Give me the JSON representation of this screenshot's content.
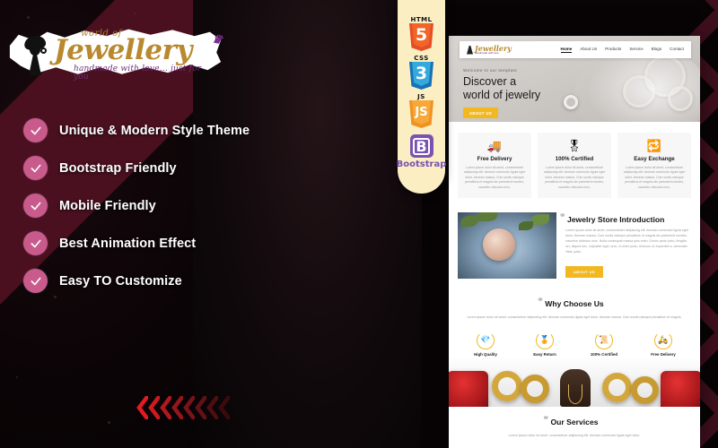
{
  "brand": {
    "pre": "world of",
    "name": "Jewellery",
    "tagline": "handmade with love... just for you",
    "crown_icon": "crown-icon",
    "accent_gold": "#b8892f",
    "accent_purple": "#6d2e7e"
  },
  "features": {
    "check_color": "#c85b8c",
    "items": [
      {
        "label": "Unique & Modern Style Theme"
      },
      {
        "label": "Bootstrap Friendly"
      },
      {
        "label": "Mobile Friendly"
      },
      {
        "label": "Best Animation Effect"
      },
      {
        "label": "Easy TO Customize"
      }
    ]
  },
  "tech_badges": {
    "panel_color": "#fbeec3",
    "items": [
      {
        "cap": "HTML",
        "num": "5",
        "color": "#e44d26",
        "inner": "#f16529",
        "icon": "html5-icon"
      },
      {
        "cap": "CSS",
        "num": "3",
        "color": "#1572b6",
        "inner": "#33a9dc",
        "icon": "css3-icon"
      },
      {
        "cap": "JS",
        "num": "JS",
        "color": "#f7941e",
        "inner": "#f7941e",
        "icon": "javascript-icon"
      },
      {
        "cap": "",
        "num": "B",
        "color": "#7952b3",
        "inner": "#7952b3",
        "icon": "bootstrap-icon",
        "label": "Bootstrap"
      }
    ]
  },
  "mockup": {
    "nav": {
      "logo_pre": "world of",
      "logo_name": "Jewellery",
      "logo_sub": "handmade with love",
      "links": [
        {
          "label": "Home",
          "active": true
        },
        {
          "label": "About Us",
          "active": false
        },
        {
          "label": "Products",
          "active": false
        },
        {
          "label": "Service",
          "active": false
        },
        {
          "label": "Blogs",
          "active": false
        },
        {
          "label": "Contact",
          "active": false
        }
      ]
    },
    "hero": {
      "eyebrow": "Welcome to our template",
      "title_line1": "Discover a",
      "title_line2": "world of jewelry",
      "button": "ABOUT US",
      "button_color": "#f1b821"
    },
    "cards": [
      {
        "icon": "delivery-truck-icon",
        "glyph": "🚚",
        "title": "Free Delivery",
        "body": "Lorem ipsum dolor sit amet, consectetuer adipiscing elit. Aenean commodo ligula eget dolor. Aenean massa. Cum sociis natoque penatibus et magnis dis parturient montes, nascetur ridiculus mus."
      },
      {
        "icon": "certified-badge-icon",
        "glyph": "🎖",
        "title": "100% Certified",
        "body": "Lorem ipsum dolor sit amet, consectetuer adipiscing elit. Aenean commodo ligula eget dolor. Aenean massa. Cum sociis natoque penatibus et magnis dis parturient montes, nascetur ridiculus mus."
      },
      {
        "icon": "exchange-arrows-icon",
        "glyph": "🔁",
        "title": "Easy Exchange",
        "body": "Lorem ipsum dolor sit amet, consectetuer adipiscing elit. Aenean commodo ligula eget dolor. Aenean massa. Cum sociis natoque penatibus et magnis dis parturient montes, nascetur ridiculus mus."
      }
    ],
    "intro": {
      "heading": "Jewelry Store Introduction",
      "body": "Lorem ipsum dolor sit amet, consectetuer adipiscing elit. Aenean commodo ligula eget dolor. Aenean massa. Cum sociis natoque penatibus et magnis dis parturient montes, nascetur ridiculus mus. Nulla consequat massa quis enim. Donec pede justo, fringilla vel, aliquet nec, vulputate eget, arcu. In enim justo, rhoncus ut, imperdiet a, venenatis vitae, justo.",
      "button": "ABOUT US",
      "image_alt": "jewelry-pendant-photo"
    },
    "why": {
      "heading": "Why Choose Us",
      "body": "Lorem ipsum dolor sit amet, consectetuer adipiscing elit. Aenean commodo ligula eget dolor. Aenean massa. Cum sociis natoque penatibus et magnis.",
      "items": [
        {
          "label": "High Quality",
          "icon": "diamond-icon",
          "glyph": "💎"
        },
        {
          "label": "Easy Return",
          "icon": "return-icon",
          "glyph": "🏅"
        },
        {
          "label": "100% Certified",
          "icon": "certificate-icon",
          "glyph": "📜"
        },
        {
          "label": "Free Delivery",
          "icon": "delivery-icon",
          "glyph": "🛵"
        }
      ]
    },
    "services": {
      "heading": "Our Services",
      "body": "Lorem ipsum dolor sit amet, consectetuer adipiscing elit. Aenean commodo ligula eget dolor."
    }
  },
  "decor": {
    "arrow_color_bright": "#e01b24",
    "arrow_color_dark": "#4a0d14",
    "chevron_color": "#3e0f1c",
    "band_color": "#4a101f"
  }
}
